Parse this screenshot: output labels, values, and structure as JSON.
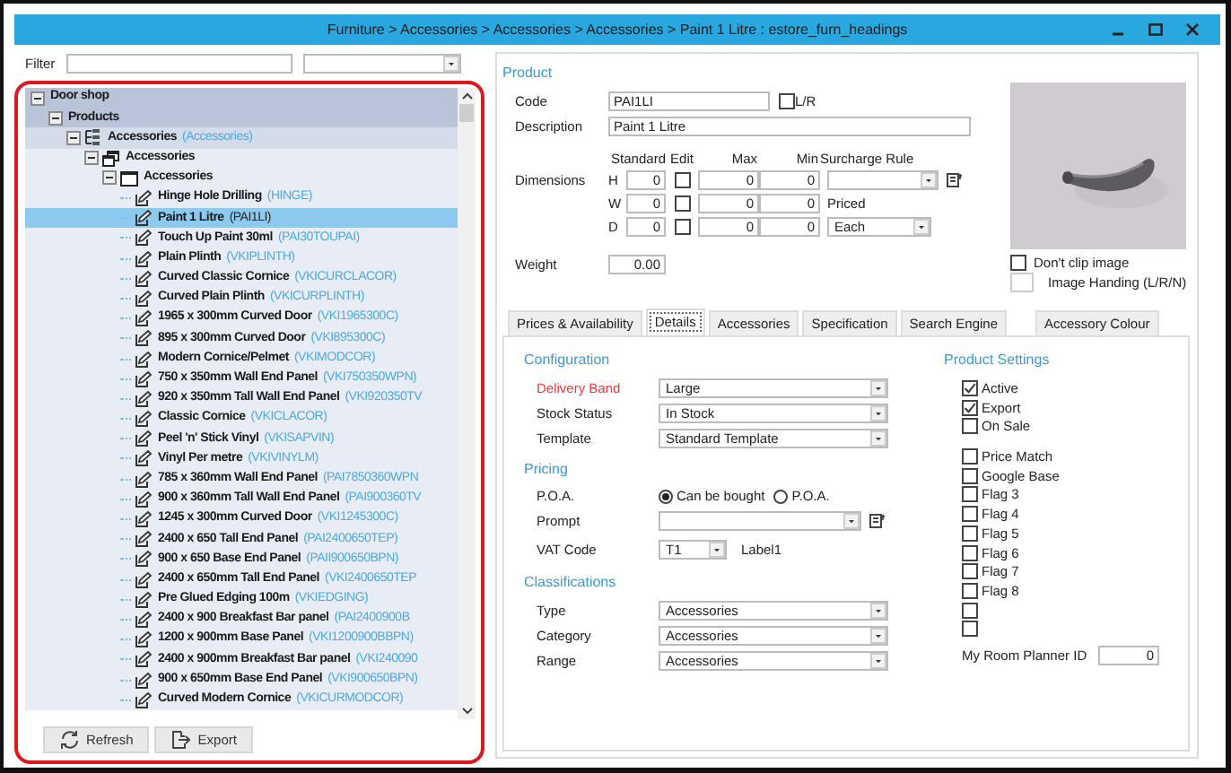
{
  "window": {
    "title": "Furniture > Accessories > Accessories > Accessories > Paint 1 Litre : estore_furn_headings"
  },
  "filter": {
    "label": "Filter"
  },
  "tree": {
    "nodes": [
      {
        "label": "Door shop",
        "expanded": true,
        "selected": false,
        "children": [
          {
            "label": "Products",
            "expanded": true,
            "selected": false,
            "children": [
              {
                "label": "Accessories",
                "code": "(Accessories)",
                "kind": "category",
                "expanded": true,
                "selected": false,
                "children": [
                  {
                    "label": "Accessories",
                    "kind": "range",
                    "expanded": true,
                    "selected": false,
                    "children": [
                      {
                        "label": "Accessories",
                        "kind": "folder",
                        "expanded": true,
                        "selected": false,
                        "children": [
                          {
                            "label": "Hinge Hole Drilling",
                            "code": "(HINGE)",
                            "kind": "product",
                            "selected": false
                          },
                          {
                            "label": "Paint 1 Litre",
                            "code": "(PAI1LI)",
                            "kind": "product",
                            "selected": true
                          },
                          {
                            "label": "Touch Up Paint 30ml",
                            "code": "(PAI30TOUPAI)",
                            "kind": "product",
                            "selected": false
                          },
                          {
                            "label": "Plain Plinth",
                            "code": "(VKIPLINTH)",
                            "kind": "product",
                            "selected": false
                          },
                          {
                            "label": "Curved Classic Cornice",
                            "code": "(VKICURCLACOR)",
                            "kind": "product",
                            "selected": false
                          },
                          {
                            "label": "Curved Plain Plinth",
                            "code": "(VKICURPLINTH)",
                            "kind": "product",
                            "selected": false
                          },
                          {
                            "label": "1965 x 300mm Curved Door",
                            "code": "(VKI1965300C)",
                            "kind": "product",
                            "selected": false
                          },
                          {
                            "label": "895 x 300mm Curved Door",
                            "code": "(VKI895300C)",
                            "kind": "product",
                            "selected": false
                          },
                          {
                            "label": "Modern Cornice/Pelmet",
                            "code": "(VKIMODCOR)",
                            "kind": "product",
                            "selected": false
                          },
                          {
                            "label": "750 x 350mm Wall End Panel",
                            "code": "(VKI750350WPN)",
                            "kind": "product",
                            "selected": false
                          },
                          {
                            "label": "920 x 350mm Tall Wall End Panel",
                            "code": "(VKI920350TV",
                            "kind": "product",
                            "selected": false
                          },
                          {
                            "label": "Classic Cornice",
                            "code": "(VKICLACOR)",
                            "kind": "product",
                            "selected": false
                          },
                          {
                            "label": "Peel 'n' Stick Vinyl",
                            "code": "(VKISAPVIN)",
                            "kind": "product",
                            "selected": false
                          },
                          {
                            "label": "Vinyl Per metre",
                            "code": "(VKIVINYLM)",
                            "kind": "product",
                            "selected": false
                          },
                          {
                            "label": "785 x 360mm Wall End Panel",
                            "code": "(PAI7850360WPN",
                            "kind": "product",
                            "selected": false
                          },
                          {
                            "label": "900 x 360mm Tall Wall End Panel",
                            "code": "(PAI900360TV",
                            "kind": "product",
                            "selected": false
                          },
                          {
                            "label": "1245 x 300mm Curved Door",
                            "code": "(VKI1245300C)",
                            "kind": "product",
                            "selected": false
                          },
                          {
                            "label": "2400 x 650 Tall End Panel",
                            "code": "(PAI2400650TEP)",
                            "kind": "product",
                            "selected": false
                          },
                          {
                            "label": "900 x 650 Base End Panel",
                            "code": "(PAII900650BPN)",
                            "kind": "product",
                            "selected": false
                          },
                          {
                            "label": "2400 x 650mm Tall End Panel",
                            "code": "(VKI2400650TEP",
                            "kind": "product",
                            "selected": false
                          },
                          {
                            "label": "Pre Glued Edging 100m",
                            "code": "(VKIEDGING)",
                            "kind": "product",
                            "selected": false
                          },
                          {
                            "label": "2400 x 900 Breakfast Bar panel",
                            "code": "(PAI2400900B",
                            "kind": "product",
                            "selected": false
                          },
                          {
                            "label": "1200 x 900mm Base Panel",
                            "code": "(VKI1200900BBPN)",
                            "kind": "product",
                            "selected": false
                          },
                          {
                            "label": "2400 x 900mm Breakfast Bar panel",
                            "code": "(VKI240090",
                            "kind": "product",
                            "selected": false
                          },
                          {
                            "label": "900 x 650mm Base End Panel",
                            "code": "(VKI900650BPN)",
                            "kind": "product",
                            "selected": false
                          },
                          {
                            "label": "Curved Modern Cornice",
                            "code": "(VKICURMODCOR)",
                            "kind": "product",
                            "selected": false
                          }
                        ]
                      }
                    ]
                  }
                ]
              }
            ]
          }
        ]
      }
    ]
  },
  "tree_buttons": [
    {
      "label": "Refresh",
      "kind": "refresh"
    },
    {
      "label": "Export",
      "kind": "export"
    }
  ],
  "product": {
    "heading": "Product",
    "code": {
      "label": "Code",
      "value": "PAI1LI"
    },
    "lr": {
      "label": "L/R",
      "checked": false
    },
    "description": {
      "label": "Description",
      "value": "Paint 1 Litre"
    },
    "dimensions": {
      "label": "Dimensions",
      "headers": [
        "Standard",
        "Edit",
        "Max",
        "Min"
      ],
      "rows": [
        {
          "axis": "H",
          "standard": "0",
          "edit": false,
          "max": "0",
          "min": "0"
        },
        {
          "axis": "W",
          "standard": "0",
          "edit": false,
          "max": "0",
          "min": "0"
        },
        {
          "axis": "D",
          "standard": "0",
          "edit": false,
          "max": "0",
          "min": "0"
        }
      ]
    },
    "surcharge_rule": {
      "label": "Surcharge Rule"
    },
    "priced": {
      "label": "Priced",
      "value": "Each"
    },
    "weight": {
      "label": "Weight",
      "value": "0.00"
    },
    "dont_clip": {
      "label": "Don't clip image",
      "checked": false
    },
    "image_handing": {
      "label": "Image Handing (L/R/N)"
    }
  },
  "tabs": [
    {
      "label": "Prices & Availability",
      "selected": false
    },
    {
      "label": "Details",
      "selected": true
    },
    {
      "label": "Accessories",
      "selected": false
    },
    {
      "label": "Specification",
      "selected": false
    },
    {
      "label": "Search Engine",
      "selected": false
    },
    {
      "label": "Accessory Colour",
      "selected": false
    }
  ],
  "details": {
    "configuration": {
      "heading": "Configuration",
      "fields": [
        {
          "label": "Delivery Band",
          "value": "Large",
          "required": true
        },
        {
          "label": "Stock Status",
          "value": "In Stock",
          "required": false
        },
        {
          "label": "Template",
          "value": "Standard Template",
          "required": false
        }
      ]
    },
    "pricing": {
      "heading": "Pricing",
      "poa": {
        "label": "P.O.A.",
        "options": [
          {
            "label": "Can be bought",
            "selected": true
          },
          {
            "label": "P.O.A.",
            "selected": false
          }
        ]
      },
      "prompt": {
        "label": "Prompt"
      },
      "vat_code": {
        "label": "VAT Code",
        "value": "T1",
        "note": "Label1"
      }
    },
    "classifications": {
      "heading": "Classifications",
      "fields": [
        {
          "label": "Type",
          "value": "Accessories"
        },
        {
          "label": "Category",
          "value": "Accessories"
        },
        {
          "label": "Range",
          "value": "Accessories"
        }
      ]
    },
    "product_settings": {
      "heading": "Product Settings",
      "groups": [
        {
          "options": [
            {
              "label": "Active",
              "checked": true
            },
            {
              "label": "Export",
              "checked": true
            },
            {
              "label": "On Sale",
              "checked": false
            }
          ]
        },
        {
          "options": [
            {
              "label": "Price Match",
              "checked": false
            },
            {
              "label": "Google Base",
              "checked": false
            },
            {
              "label": "Flag 3",
              "checked": false
            },
            {
              "label": "Flag 4",
              "checked": false
            },
            {
              "label": "Flag 5",
              "checked": false
            },
            {
              "label": "Flag 6",
              "checked": false
            },
            {
              "label": "Flag 7",
              "checked": false
            },
            {
              "label": "Flag 8",
              "checked": false
            },
            {
              "checked": false
            },
            {
              "checked": false
            }
          ]
        }
      ],
      "planner": {
        "label": "My Room Planner ID",
        "value": "0"
      }
    }
  }
}
